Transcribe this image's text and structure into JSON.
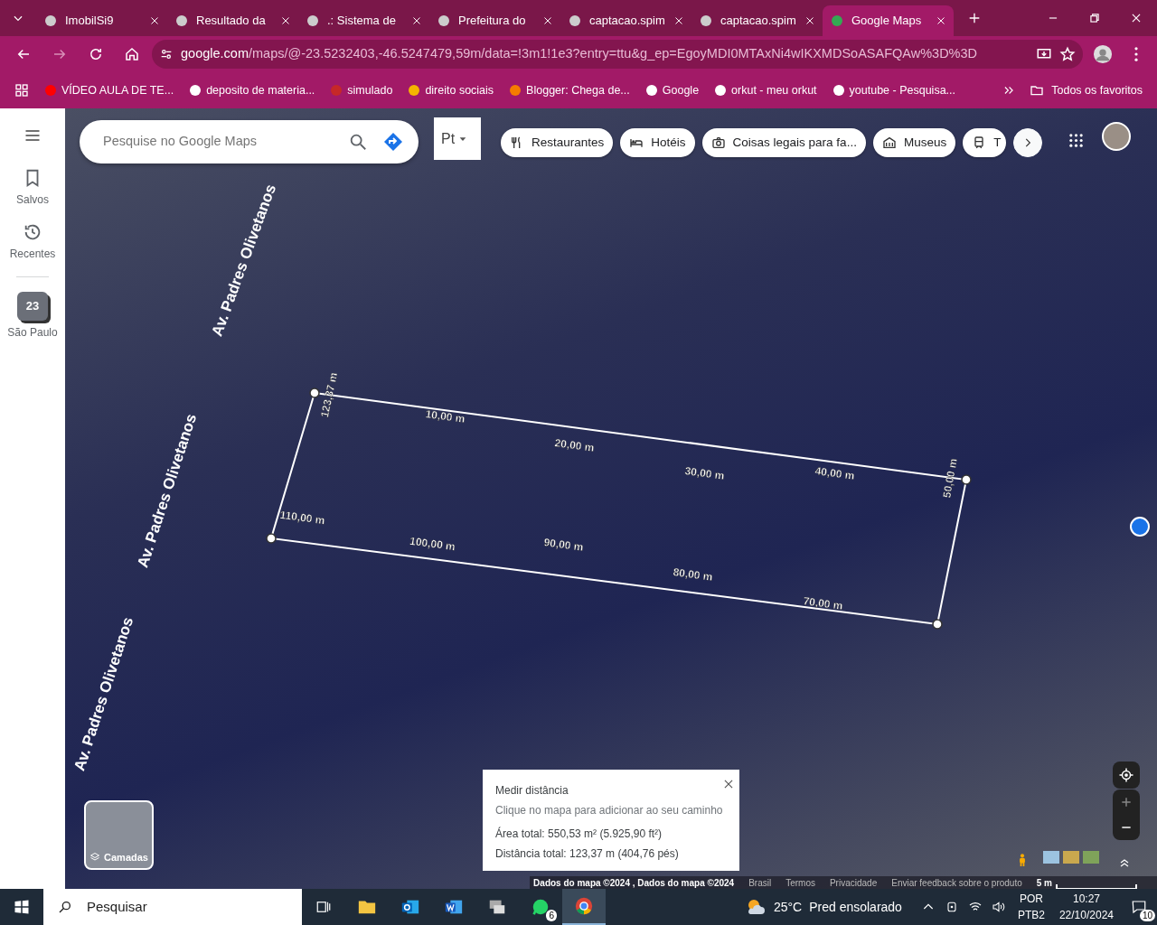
{
  "browser": {
    "tabs": [
      {
        "title": "ImobilSi9",
        "selected": false
      },
      {
        "title": "Resultado da",
        "selected": false
      },
      {
        "title": ".: Sistema de",
        "selected": false
      },
      {
        "title": "Prefeitura do",
        "selected": false
      },
      {
        "title": "captacao.spim",
        "selected": false
      },
      {
        "title": "captacao.spim",
        "selected": false
      },
      {
        "title": "Google Maps",
        "selected": true
      }
    ],
    "address": {
      "host": "google.com",
      "path": "/maps/@-23.5232403,-46.5247479,59m/data=!3m1!1e3?entry=ttu&g_ep=EgoyMDI0MTAxNi4wIKXMDSoASAFQAw%3D%3D"
    },
    "bookmarks": [
      "VÍDEO AULA DE TE...",
      "deposito de materia...",
      "simulado",
      "direito sociais",
      "Blogger: Chega de...",
      "Google",
      "orkut - meu orkut",
      "youtube - Pesquisa..."
    ],
    "all_bookmarks": "Todos os favoritos"
  },
  "maps": {
    "sidebar": [
      {
        "label": "Salvos"
      },
      {
        "label": "Recentes"
      },
      {
        "label": "São Paulo",
        "badge": "23"
      }
    ],
    "search": {
      "placeholder": "Pesquise no Google Maps"
    },
    "mode_button": "Pt",
    "chips": [
      "Restaurantes",
      "Hotéis",
      "Coisas legais para fa...",
      "Museus",
      "T"
    ],
    "street_labels": [
      "Av. Padres Olivetanos",
      "Av. Padres Olivetanos",
      "Av. Padres Olivetanos"
    ],
    "measure_labels": [
      "123,37 m",
      "10,00 m",
      "20,00 m",
      "30,00 m",
      "40,00 m",
      "50,00 m",
      "70,00 m",
      "80,00 m",
      "90,00 m",
      "100,00 m",
      "110,00 m"
    ],
    "measure_panel": {
      "title": "Medir distância",
      "hint": "Clique no mapa para adicionar ao seu caminho",
      "area": "Área total: 550,53 m² (5.925,90 ft²)",
      "distance": "Distância total: 123,37 m (404,76 pés)"
    },
    "layers_label": "Camadas",
    "footer": [
      "Dados do mapa ©2024 , Dados do mapa ©2024",
      "Brasil",
      "Termos",
      "Privacidade",
      "Enviar feedback sobre o produto"
    ],
    "scale": "5 m"
  },
  "taskbar": {
    "search": "Pesquisar",
    "apps": [
      {
        "kind": "files",
        "selected": false
      },
      {
        "kind": "outlook",
        "selected": false
      },
      {
        "kind": "word",
        "selected": false
      },
      {
        "kind": "remote",
        "selected": false
      },
      {
        "kind": "whatsapp",
        "selected": false,
        "badge": "6"
      },
      {
        "kind": "chrome",
        "selected": true
      }
    ],
    "temperature": "25°C",
    "weather": "Pred ensolarado",
    "language": "POR",
    "layout": "PTB2",
    "time": "10:27",
    "date": "22/10/2024",
    "notifications": "10"
  }
}
